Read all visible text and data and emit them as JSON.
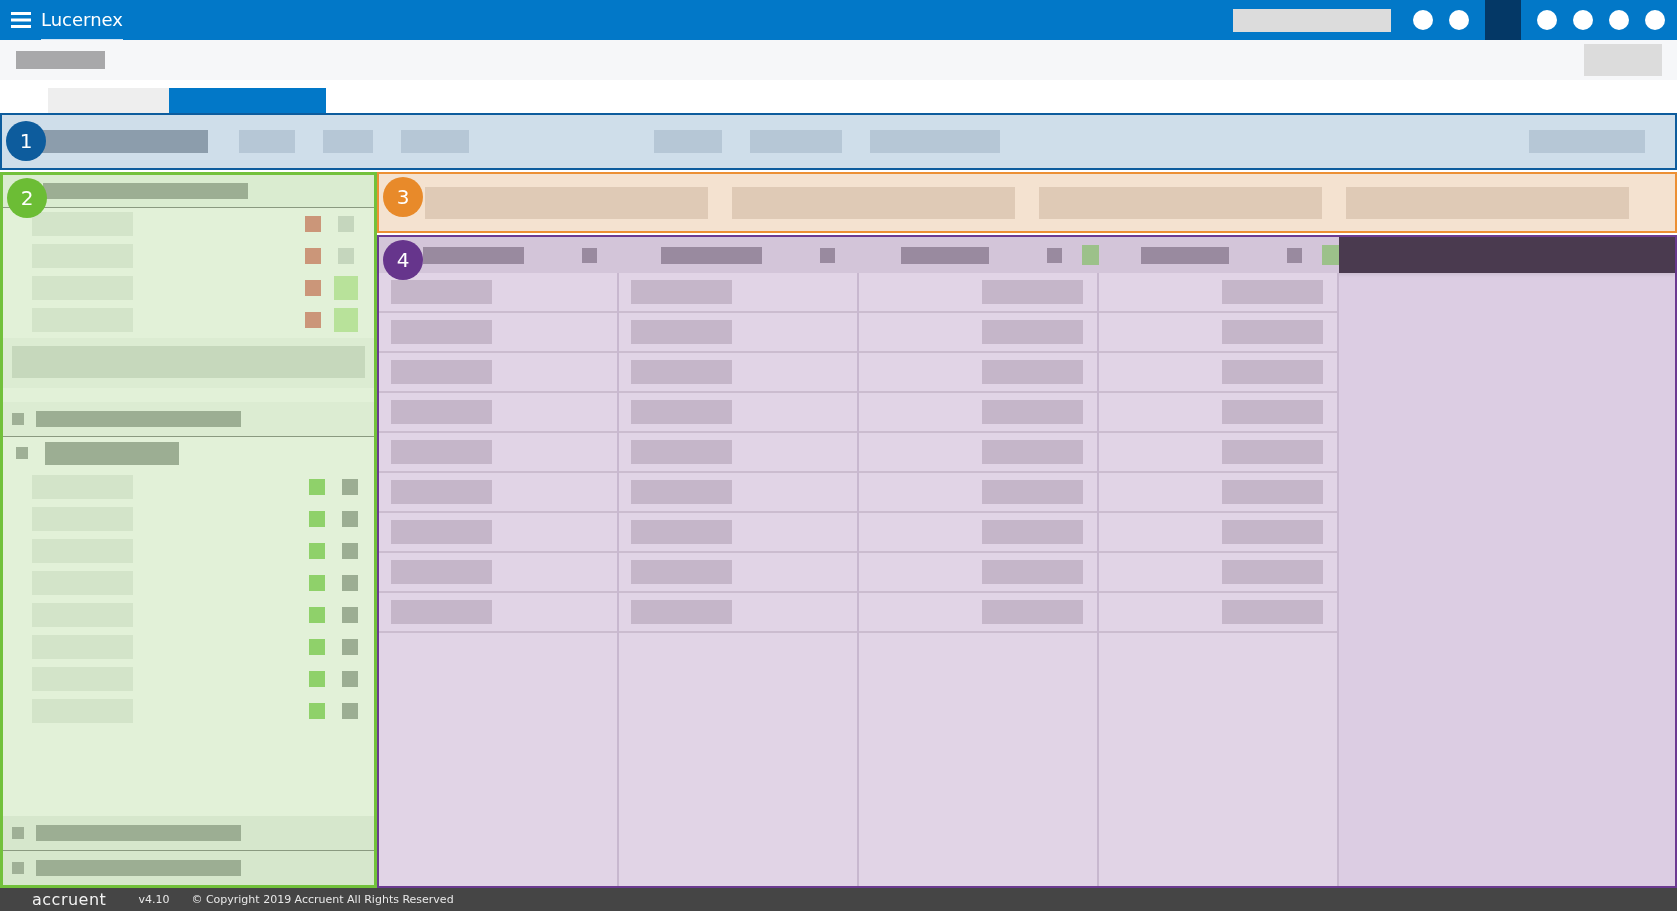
{
  "header": {
    "title": "Lucernex"
  },
  "tabs": [
    {
      "selected": false
    },
    {
      "selected": true
    }
  ],
  "action_bar": {
    "badge": "1"
  },
  "sidebar": {
    "badge": "2",
    "top_rows": [
      {
        "checked": false
      },
      {
        "checked": false
      },
      {
        "checked": true
      },
      {
        "checked": true
      }
    ]
  },
  "filters": {
    "badge": "3"
  },
  "grid": {
    "badge": "4",
    "columns": [
      {
        "filtered": false
      },
      {
        "filtered": false
      },
      {
        "filtered": true
      },
      {
        "filtered": true
      }
    ]
  },
  "footer": {
    "logo": "accruent",
    "version": "v4.10",
    "copyright": "© Copyright 2019 Accruent All Rights Reserved"
  }
}
